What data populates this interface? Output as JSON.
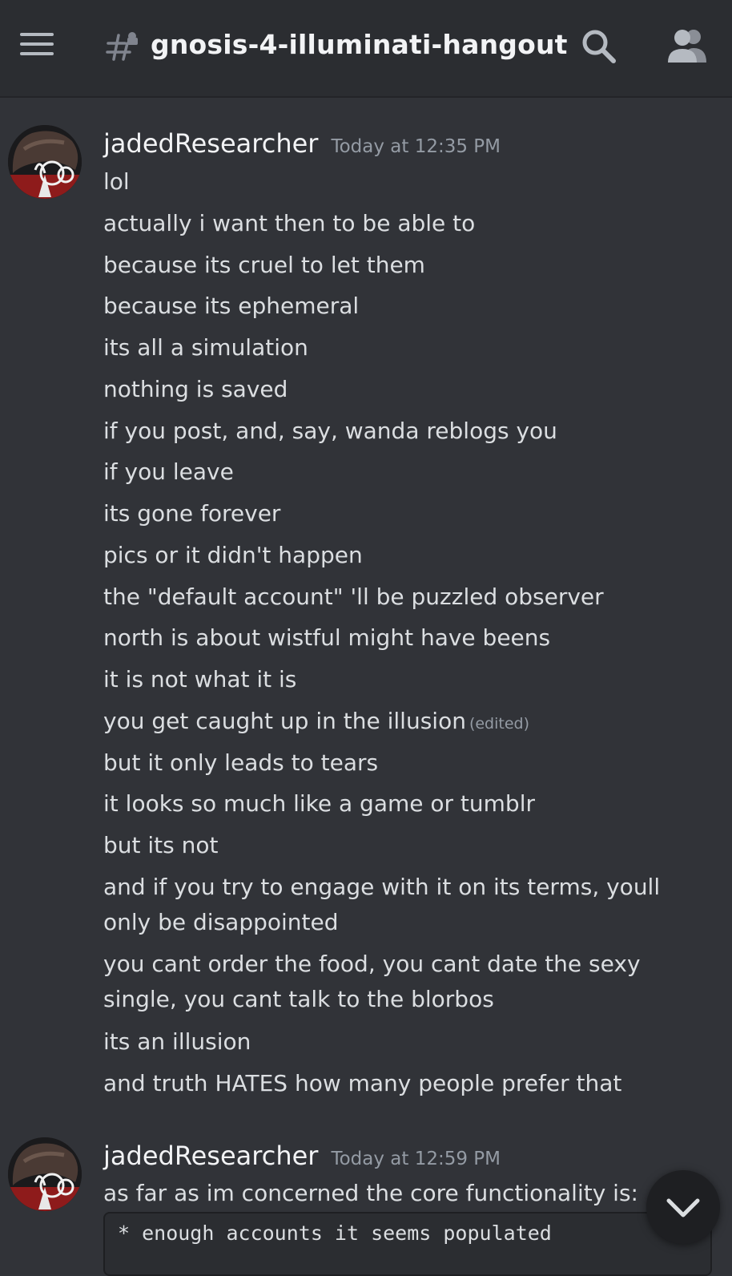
{
  "header": {
    "channel_name": "gnosis-4-illuminati-hangout"
  },
  "messages": [
    {
      "author": "jadedResearcher",
      "timestamp": "Today at 12:35 PM",
      "lines": [
        "lol",
        "actually i want then to be able to",
        "because its cruel to let them",
        "because its ephemeral",
        "its all a simulation",
        "nothing is saved",
        "if you post, and, say, wanda reblogs you",
        "if you leave",
        "its gone forever",
        "pics or it didn't happen",
        "the \"default account\" 'll be puzzled observer",
        "north is about wistful might have beens",
        "it is not what it is",
        "you get caught up in the illusion",
        "but it only leads to tears",
        "it looks so much like a game or tumblr",
        "but its not",
        "and if you try to engage with it on its terms, youll only be disappointed",
        "you cant order the food, you cant date the sexy single, you cant talk to the blorbos",
        "its an illusion",
        "and truth HATES how many people prefer that"
      ],
      "edited_label": "(edited)"
    },
    {
      "author": "jadedResearcher",
      "timestamp": "Today at 12:59 PM",
      "lines": [
        "as far as im concerned the core functionality is:"
      ],
      "code": "* enough accounts it seems populated"
    }
  ],
  "icons": {
    "menu": "hamburger-icon",
    "channel": "threaded-channel-icon",
    "search": "search-icon",
    "members": "members-icon",
    "jump": "chevron-down-icon"
  }
}
